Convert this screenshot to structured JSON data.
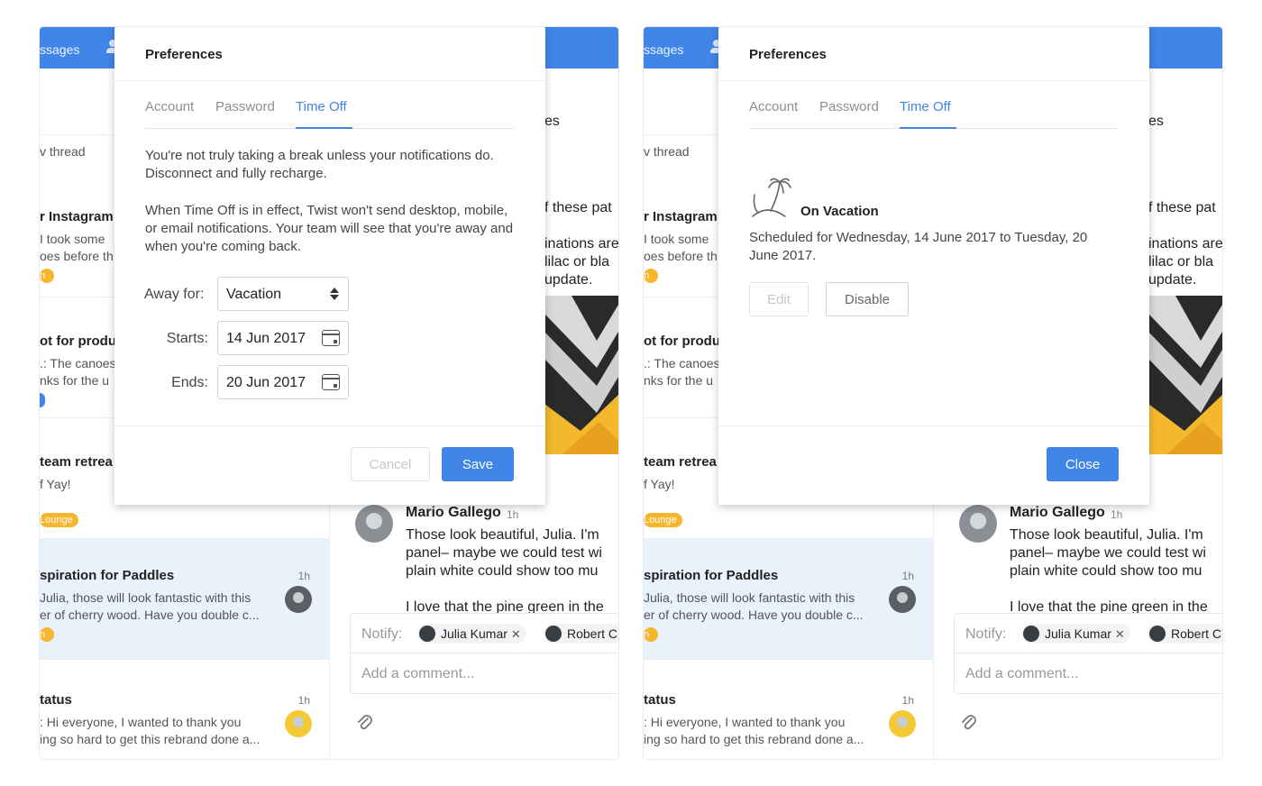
{
  "background_app": {
    "topbar_text": "ssages",
    "list_subtitle": "v thread",
    "threads": [
      {
        "title": "r Instagram a",
        "snippet1": "I took some",
        "snippet2": "oes before th",
        "tag": "n"
      },
      {
        "title": "ot for produ",
        "snippet1": ".: The canoes",
        "snippet2": "nks for the u"
      },
      {
        "title": "team retrea",
        "snippet1": "f Yay!",
        "tag": "Lounge"
      },
      {
        "title": "spiration for Paddles",
        "snippet1": "Julia, those will look fantastic with this",
        "snippet2": "er of cherry wood.  Have you double c...",
        "time": "1h",
        "tag": "n"
      },
      {
        "title": "tatus",
        "snippet1": ": Hi everyone,  I wanted to thank you",
        "snippet2": "ing so hard to get this rebrand done a...",
        "time": "1h"
      }
    ],
    "right_snippets": {
      "line_es": "es",
      "line_patterns": "f these pat",
      "line_combinations": "inations are",
      "line_lilac": "lilac or bla",
      "line_update": "update."
    },
    "message": {
      "author": "Mario Gallego",
      "time": "1h",
      "line1": "Those look beautiful, Julia. I'm",
      "line2": "panel– maybe we could test wi",
      "line3": "plain white could show too mu",
      "line4": "I love that the pine green in the"
    },
    "composer": {
      "notify_label": "Notify:",
      "chip1": "Julia Kumar",
      "chip2": "Robert C",
      "chip_remove": "✕",
      "placeholder": "Add a comment..."
    }
  },
  "modal": {
    "title": "Preferences",
    "tabs": [
      "Account",
      "Password",
      "Time Off"
    ]
  },
  "left": {
    "para1": "You're not truly taking a break unless your notifications do. Disconnect and fully recharge.",
    "para2": "When Time Off is in effect, Twist won't send desktop, mobile, or email notifications. Your team will see that you're away and when you're coming back.",
    "away_label": "Away for:",
    "away_value": "Vacation",
    "starts_label": "Starts:",
    "starts_value": "14 Jun 2017",
    "ends_label": "Ends:",
    "ends_value": "20 Jun 2017",
    "cancel": "Cancel",
    "save": "Save"
  },
  "right": {
    "status_title": "On Vacation",
    "status_desc": "Scheduled for Wednesday, 14 June 2017 to Tuesday, 20 June 2017.",
    "edit": "Edit",
    "disable": "Disable",
    "close": "Close"
  },
  "colors": {
    "accent": "#3f86e8",
    "tag_orange": "#f6b62d"
  }
}
